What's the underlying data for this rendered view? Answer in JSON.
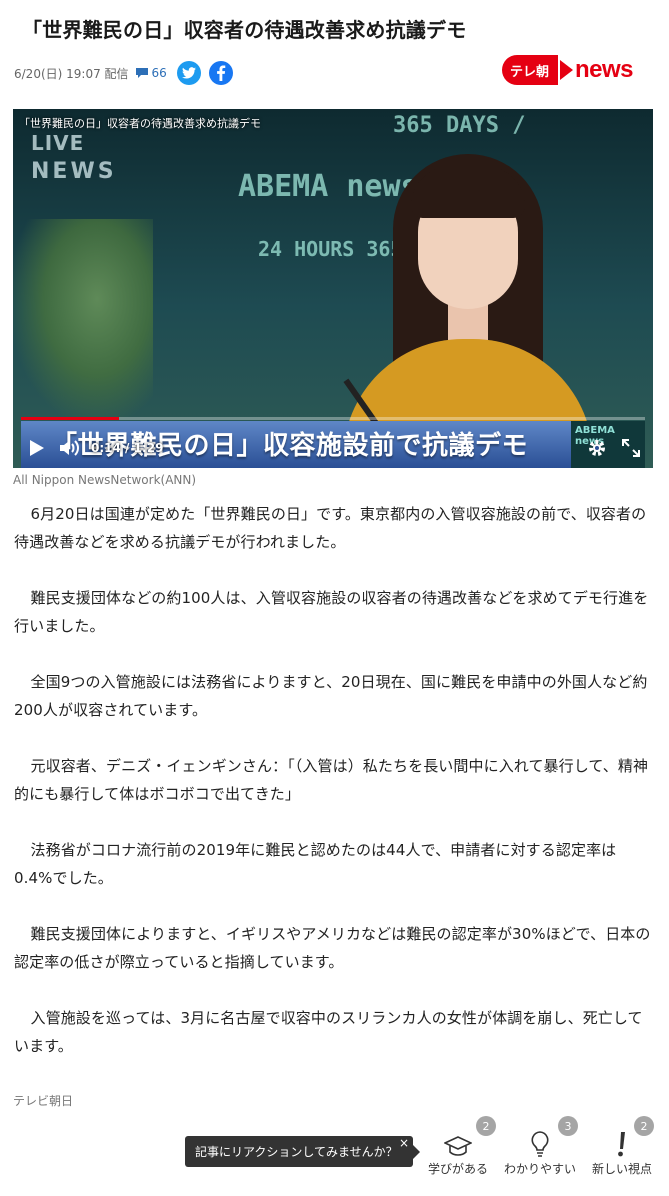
{
  "article": {
    "title": "「世界難民の日」収容者の待遇改善求め抗議デモ",
    "date": "6/20(日) 19:07 配信",
    "comment_count": "66",
    "paragraphs": [
      "6月20日は国連が定めた「世界難民の日」です。東京都内の入管収容施設の前で、収容者の待遇改善などを求める抗議デモが行われました。",
      "難民支援団体などの約100人は、入管収容施設の収容者の待遇改善などを求めてデモ行進を行いました。",
      "全国9つの入管施設には法務省によりますと、20日現在、国に難民を申請中の外国人など約200人が収容されています。",
      "元収容者、デニズ・イェンギンさん：「（入管は）私たちを長い間中に入れて暴行して、精神的にも暴行して体はボコボコで出てきた」",
      "法務省がコロナ流行前の2019年に難民と認めたのは44人で、申請者に対する認定率は0.4%でした。",
      "難民支援団体によりますと、イギリスやアメリカなどは難民の認定率が30%ほどで、日本の認定率の低さが際立っていると指摘しています。",
      "入管施設を巡っては、3月に名古屋で収容中のスリランカ人の女性が体調を崩し、死亡しています。"
    ],
    "source": "テレビ朝日"
  },
  "logo": {
    "badge": "テレ朝",
    "text": "news",
    "color": "#e50012"
  },
  "video": {
    "caption": "「世界難民の日」収容者の待遇改善求め抗議デモ",
    "channel_logo": "LIVE",
    "channel_logo_sub": "NEWS",
    "bg_sign_1": "365 DAYS /",
    "bg_sign_2": "ABEMA news /",
    "bg_sign_3": "24 HOURS 365 DAY",
    "lower_third": "「世界難民の日」収容施設前で抗議デモ",
    "abema_label": "ABEMA news",
    "time": "0:14 / 1:29",
    "progress": 0.157,
    "credit": "All Nippon NewsNetwork(ANN)"
  },
  "reactions": {
    "prompt": "記事にリアクションしてみませんか？",
    "close": "×",
    "items": [
      {
        "label": "学びがある",
        "count": "2",
        "icon": "graduation-cap-icon"
      },
      {
        "label": "わかりやすい",
        "count": "3",
        "icon": "lightbulb-icon"
      },
      {
        "label": "新しい視点",
        "count": "2",
        "icon": "exclamation-icon"
      }
    ]
  }
}
